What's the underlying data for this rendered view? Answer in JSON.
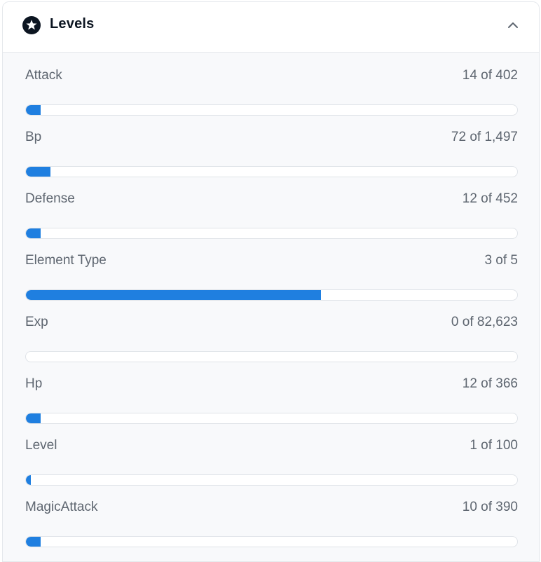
{
  "header": {
    "title": "Levels",
    "icon": "star-circle-icon",
    "collapse_icon": "chevron-up-icon"
  },
  "colors": {
    "accent": "#1f7fe0",
    "text": "#5e6670",
    "title": "#0c1521",
    "body_bg": "#f8f9fb"
  },
  "levels": [
    {
      "name": "Attack",
      "value_text": "14 of 402",
      "fraction": 0.03
    },
    {
      "name": "Bp",
      "value_text": "72 of 1,497",
      "fraction": 0.05
    },
    {
      "name": "Defense",
      "value_text": "12 of 452",
      "fraction": 0.03
    },
    {
      "name": "Element Type",
      "value_text": "3 of 5",
      "fraction": 0.6
    },
    {
      "name": "Exp",
      "value_text": "0 of 82,623",
      "fraction": 0.0
    },
    {
      "name": "Hp",
      "value_text": "12 of 366",
      "fraction": 0.03
    },
    {
      "name": "Level",
      "value_text": "1 of 100",
      "fraction": 0.01
    },
    {
      "name": "MagicAttack",
      "value_text": "10 of 390",
      "fraction": 0.03
    }
  ]
}
